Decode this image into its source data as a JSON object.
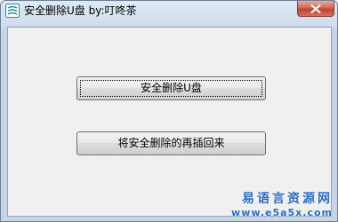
{
  "window": {
    "title": "安全删除U盘 by:叮咚茶",
    "app_icon": "usb-drive-icon",
    "close_icon": "close-icon"
  },
  "buttons": {
    "safe_remove": "安全删除U盘",
    "restore": "将安全删除的再插回来"
  },
  "watermark": {
    "line1": "易语言资源网",
    "line2": "www.e5a5x.com"
  },
  "colors": {
    "title_bar": "#cfdcec",
    "client_bg": "#f0f0f0",
    "close_button": "#c0442f",
    "watermark": "#2a6cc4"
  }
}
